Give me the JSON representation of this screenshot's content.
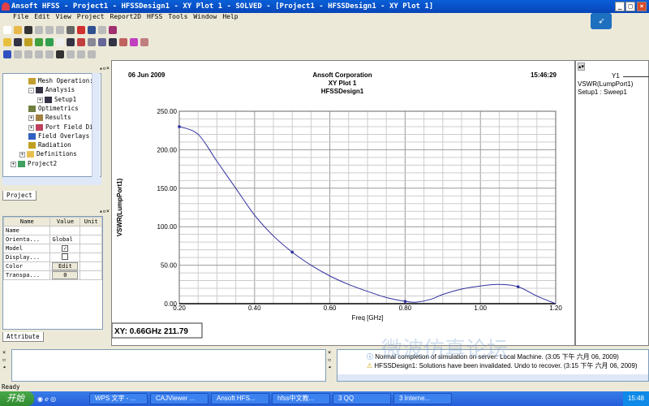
{
  "window": {
    "title": "Ansoft HFSS - Project1 - HFSSDesign1 - XY Plot 1 - SOLVED - [Project1 - HFSSDesign1 - XY Plot 1]"
  },
  "menu": [
    "File",
    "Edit",
    "View",
    "Project",
    "Report2D",
    "HFSS",
    "Tools",
    "Window",
    "Help"
  ],
  "tree": {
    "items": [
      {
        "label": "Mesh Operation:",
        "indent": 3
      },
      {
        "label": "Analysis",
        "indent": 3,
        "expander": "-"
      },
      {
        "label": "Setup1",
        "indent": 4,
        "expander": "+"
      },
      {
        "label": "Optimetrics",
        "indent": 3
      },
      {
        "label": "Results",
        "indent": 3,
        "expander": "+"
      },
      {
        "label": "Port Field Dis",
        "indent": 3,
        "expander": "+"
      },
      {
        "label": "Field Overlays",
        "indent": 3
      },
      {
        "label": "Radiation",
        "indent": 3
      },
      {
        "label": "Definitions",
        "indent": 2,
        "expander": "+"
      },
      {
        "label": "Project2",
        "indent": 1,
        "expander": "+"
      }
    ],
    "tab": "Project"
  },
  "properties": {
    "headers": [
      "Name",
      "Value",
      "Unit"
    ],
    "rows": [
      {
        "name": "Name",
        "value": ""
      },
      {
        "name": "Orienta...",
        "value": "Global"
      },
      {
        "name": "Model",
        "value": "checked"
      },
      {
        "name": "Display...",
        "value": "unchecked"
      },
      {
        "name": "Color",
        "value": "Edit"
      },
      {
        "name": "Transpa...",
        "value": "0"
      }
    ],
    "tab": "Attribute"
  },
  "plot": {
    "date": "06 Jun 2009",
    "company": "Ansoft Corporation",
    "time": "15:46:29",
    "readout": "XY: 0.66GHz 211.79"
  },
  "legend": {
    "trace": "Y1",
    "expr": "VSWR(LumpPort1)",
    "source": "Setup1 : Sweep1"
  },
  "chart_data": {
    "type": "line",
    "title": "XY Plot 1",
    "subtitle": "HFSSDesign1",
    "xlabel": "Freq [GHz]",
    "ylabel": "VSWR(LumpPort1)",
    "xlim": [
      0.2,
      1.2
    ],
    "ylim": [
      0,
      250
    ],
    "grid": true,
    "xticks": [
      "0.20",
      "0.40",
      "0.60",
      "0.80",
      "1.00",
      "1.20"
    ],
    "yticks": [
      "0.00",
      "50.00",
      "100.00",
      "150.00",
      "200.00",
      "250.00"
    ],
    "series": [
      {
        "name": "VSWR(LumpPort1)",
        "color": "#3030a0",
        "x": [
          0.2,
          0.25,
          0.3,
          0.35,
          0.4,
          0.45,
          0.5,
          0.55,
          0.6,
          0.65,
          0.7,
          0.75,
          0.8,
          0.83,
          0.87,
          0.9,
          0.95,
          1.0,
          1.05,
          1.1,
          1.15,
          1.2
        ],
        "y": [
          230,
          220,
          185,
          150,
          115,
          88,
          67,
          50,
          36,
          25,
          16,
          8,
          3,
          2,
          6,
          12,
          19,
          23,
          25,
          22,
          10,
          0
        ]
      }
    ],
    "markers_x": [
      0.2,
      0.5,
      0.8,
      1.1
    ]
  },
  "messages": [
    "Normal completion of simulation on server: Local Machine. (3:05 下午 六月 06, 2009)",
    "HFSSDesign1: Solutions have been invalidated. Undo to recover. (3:15 下午 六月 06, 2009)"
  ],
  "status": "Ready",
  "taskbar": {
    "start": "开始",
    "tasks": [
      "WPS 文字 - ...",
      "CAJViewer ...",
      "Ansoft HFS...",
      "hfss中文教...",
      "3 QQ",
      "3 Interne..."
    ],
    "clock": "15:48"
  },
  "watermark": "微波仿真论坛 http://bbs.rfeda.cn RFEDA.CN"
}
